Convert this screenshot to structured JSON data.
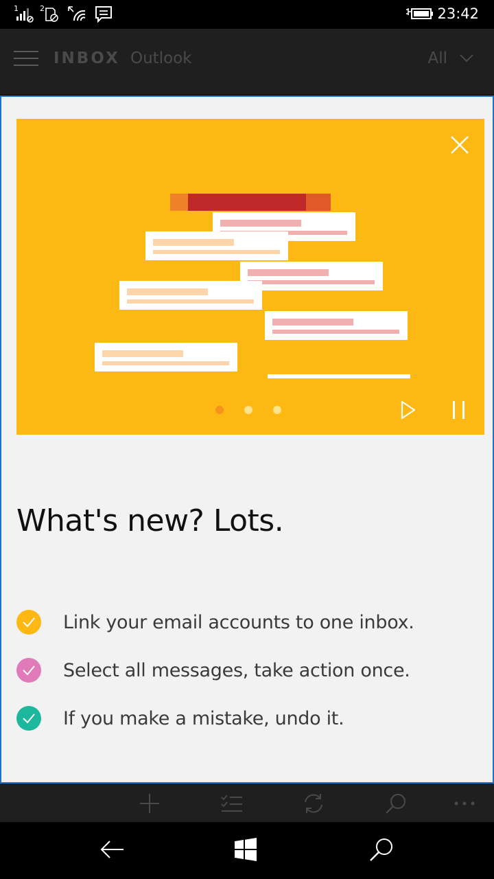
{
  "status_bar": {
    "time": "23:42",
    "sim1_label": "1",
    "sim2_label": "2",
    "icons": [
      "signal-icon",
      "sim2-no-service-icon",
      "wifi-icon",
      "message-icon",
      "battery-charging-icon"
    ]
  },
  "header": {
    "title": "INBOX",
    "account": "Outlook",
    "filter_label": "All"
  },
  "dialog": {
    "headline": "What's new? Lots.",
    "features": [
      {
        "text": "Link your email accounts to one inbox.",
        "color": "#fdb813"
      },
      {
        "text": "Select all messages, take action once.",
        "color": "#e07ab8"
      },
      {
        "text": "If you make a mistake, undo it.",
        "color": "#1db79e"
      }
    ],
    "carousel": {
      "slide_count": 3,
      "active_index": 0,
      "bg_color": "#fdb813"
    }
  },
  "app_bar": {
    "icons": [
      "add-icon",
      "select-icon",
      "sync-icon",
      "search-icon",
      "more-icon"
    ]
  },
  "nav_bar": {
    "icons": [
      "back-icon",
      "windows-icon",
      "search-icon"
    ]
  },
  "colors": {
    "accent": "#1e73c8",
    "header_bg": "#1f1f1f",
    "dialog_bg": "#f2f2f2"
  }
}
